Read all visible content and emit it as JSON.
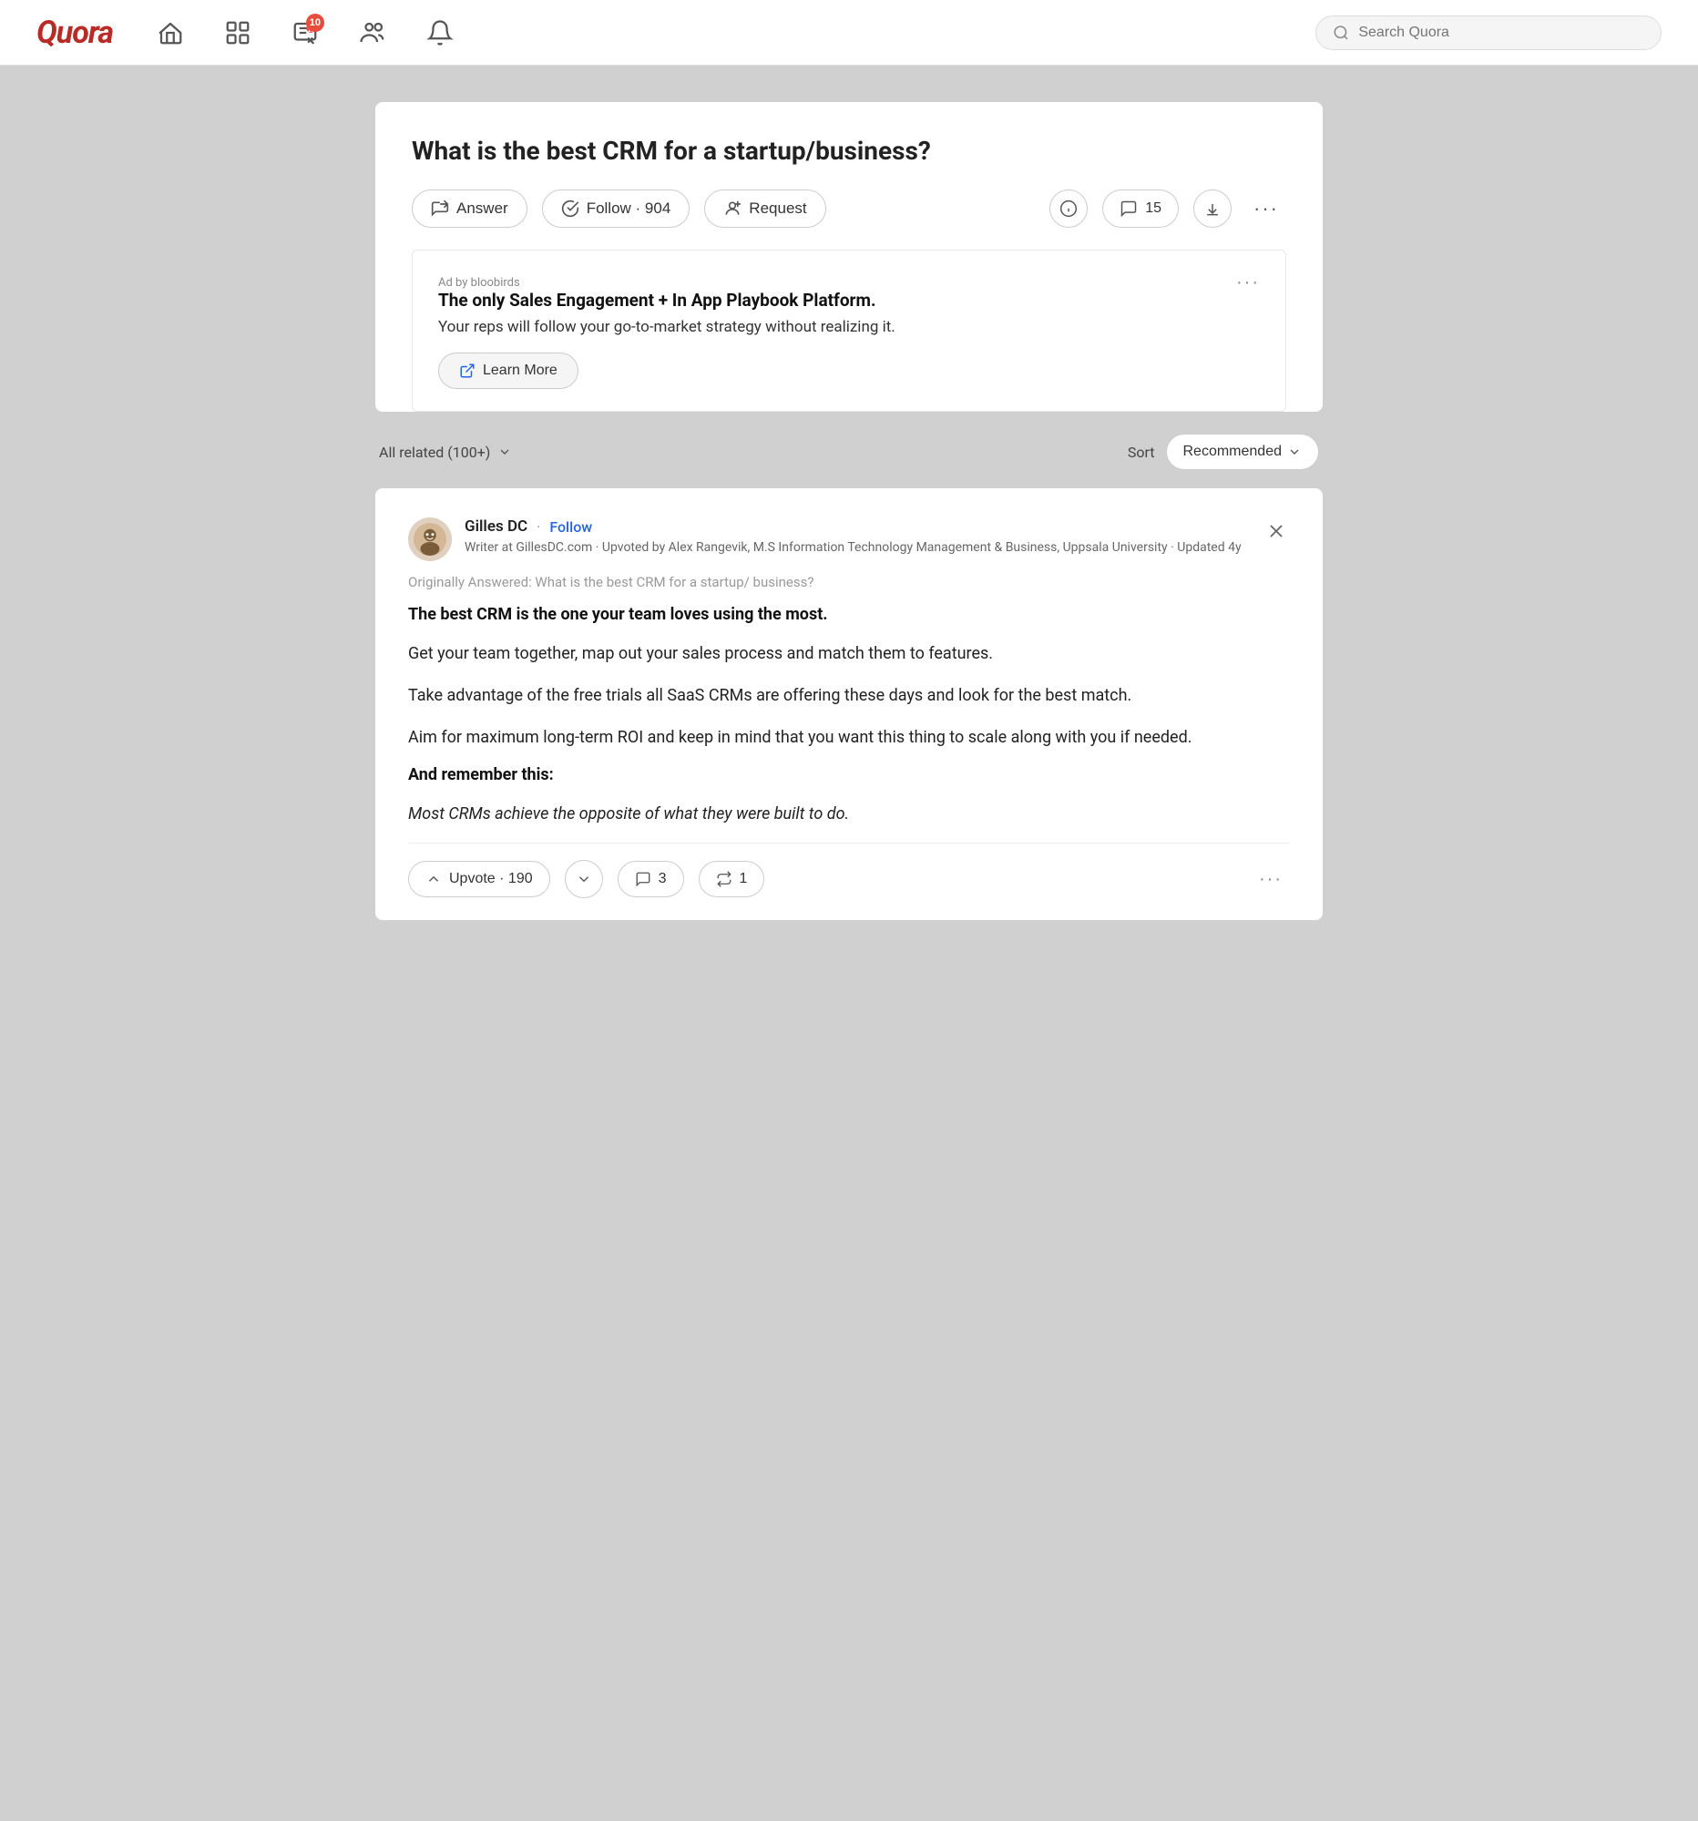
{
  "navbar": {
    "logo": "Quora",
    "search_placeholder": "Search Quora",
    "badge_count": "10",
    "nav_items": [
      {
        "name": "home",
        "icon": "home-icon"
      },
      {
        "name": "feed",
        "icon": "feed-icon"
      },
      {
        "name": "create",
        "icon": "create-icon",
        "badge": "10"
      },
      {
        "name": "spaces",
        "icon": "spaces-icon"
      },
      {
        "name": "notifications",
        "icon": "bell-icon"
      }
    ]
  },
  "question": {
    "title": "What is the best CRM for a startup/business?",
    "answer_label": "Answer",
    "follow_label": "Follow · 904",
    "request_label": "Request",
    "comment_count": "15",
    "more_dots": "···"
  },
  "ad": {
    "label": "Ad by bloobirds",
    "headline": "The only Sales Engagement + In App Playbook Platform.",
    "subtext": "Your reps will follow your go-to-market strategy without realizing it.",
    "learn_more": "Learn More",
    "menu_dots": "···"
  },
  "filter": {
    "all_related": "All related (100+)",
    "sort_label": "Sort",
    "sort_value": "Recommended"
  },
  "answer": {
    "author_name": "Gilles DC",
    "author_follow": "Follow",
    "author_meta": "Writer at GillesDC.com · Upvoted by Alex Rangevik, M.S Information Technology Management & Business, Uppsala University · Updated 4y",
    "original_question": "Originally Answered: What is the best CRM for a startup/ business?",
    "bold_line": "The best CRM is the one your team loves using the most.",
    "paragraph1": "Get your team together, map out your sales process and match them to features.",
    "paragraph2": "Take advantage of the free trials all SaaS CRMs are offering these days and look for the best match.",
    "paragraph3": "Aim for maximum long-term ROI and keep in mind that you want this thing to scale along with you if needed.",
    "subheading": "And remember this:",
    "italic_line": "Most CRMs achieve the opposite of what they were built to do.",
    "upvote_label": "Upvote · 190",
    "comment_count": "3",
    "share_count": "1",
    "more_dots": "···"
  }
}
